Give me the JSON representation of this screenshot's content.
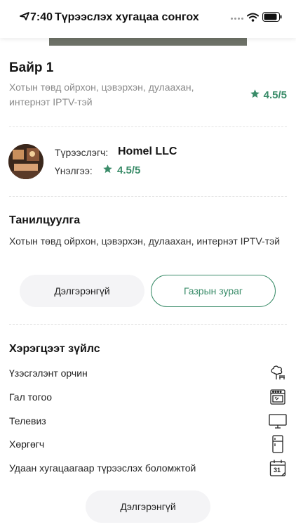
{
  "status_bar": {
    "time": "7:40"
  },
  "nav": {
    "title": "Түрээслэх хугацаа сонгох"
  },
  "listing": {
    "title": "Байр 1",
    "description": "Хотын төвд ойрхон, цэвэрхэн, дулаахан, интернэт IPTV-тэй",
    "rating": "4.5/5"
  },
  "landlord": {
    "label": "Түрээслэгч:",
    "name": "Homel LLC",
    "rating_label": "Үнэлгээ:",
    "rating": "4.5/5"
  },
  "intro": {
    "heading": "Танилцуулга",
    "text": "Хотын төвд ойрхон, цэвэрхэн, дулаахан, интернэт IPTV-тэй",
    "details_button": "Дэлгэрэнгүй",
    "map_button": "Газрын зураг"
  },
  "amenities": {
    "heading": "Хэрэгцээт зүйлс",
    "items": [
      {
        "label": "Үзэсгэлэнт орчин",
        "icon": "tree-bench-icon"
      },
      {
        "label": "Гал тогоо",
        "icon": "oven-icon"
      },
      {
        "label": "Телевиз",
        "icon": "tv-icon"
      },
      {
        "label": "Хөргөгч",
        "icon": "fridge-icon"
      },
      {
        "label": "Удаан хугацаагаар түрээслэх боломжтой",
        "icon": "calendar-icon",
        "calendar_day": "31"
      }
    ],
    "details_button": "Дэлгэрэнгүй"
  },
  "colors": {
    "accent": "#3a8c69",
    "muted_text": "#8a8a8a",
    "button_grey": "#f4f4f6"
  }
}
